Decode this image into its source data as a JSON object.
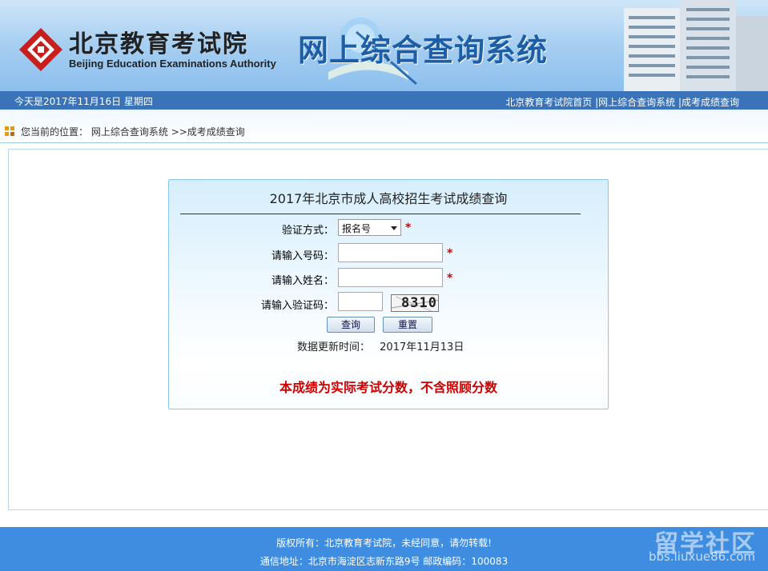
{
  "header": {
    "logo_cn": "北京教育考试院",
    "logo_en": "Beijing Education Examinations Authority",
    "system_title": "网上综合查询系统"
  },
  "datebar": {
    "date_text": "今天是2017年11月16日  星期四",
    "links": [
      "北京教育考试院首页",
      "网上综合查询系统",
      "成考成绩查询"
    ],
    "separator": " |"
  },
  "location": {
    "prefix": "您当前的位置：",
    "path": "网上综合查询系统",
    "arrow": ">>",
    "current": "成考成绩查询"
  },
  "form": {
    "title": "2017年北京市成人高校招生考试成绩查询",
    "verify_label": "验证方式：",
    "verify_selected": "报名号",
    "number_label": "请输入号码：",
    "name_label": "请输入姓名：",
    "captcha_label": "请输入验证码：",
    "captcha_text": "8310",
    "required_mark": "*",
    "query_button": "查询",
    "reset_button": "重置",
    "update_label": "数据更新时间：",
    "update_date": "2017年11月13日",
    "notice": "本成绩为实际考试分数，不含照顾分数"
  },
  "footer": {
    "copyright": "版权所有：北京教育考试院，未经同意，请勿转载!",
    "address": "通信地址：北京市海淀区志新东路9号  邮政编码：100083"
  },
  "watermark": {
    "text": "留学社区",
    "url": "bbs.liuxue86.com"
  },
  "colors": {
    "header_bar": "#3a73b7",
    "footer": "#3f8de0",
    "required": "#d40000",
    "notice": "#cc0000",
    "title_blue": "#1d5ea6"
  }
}
